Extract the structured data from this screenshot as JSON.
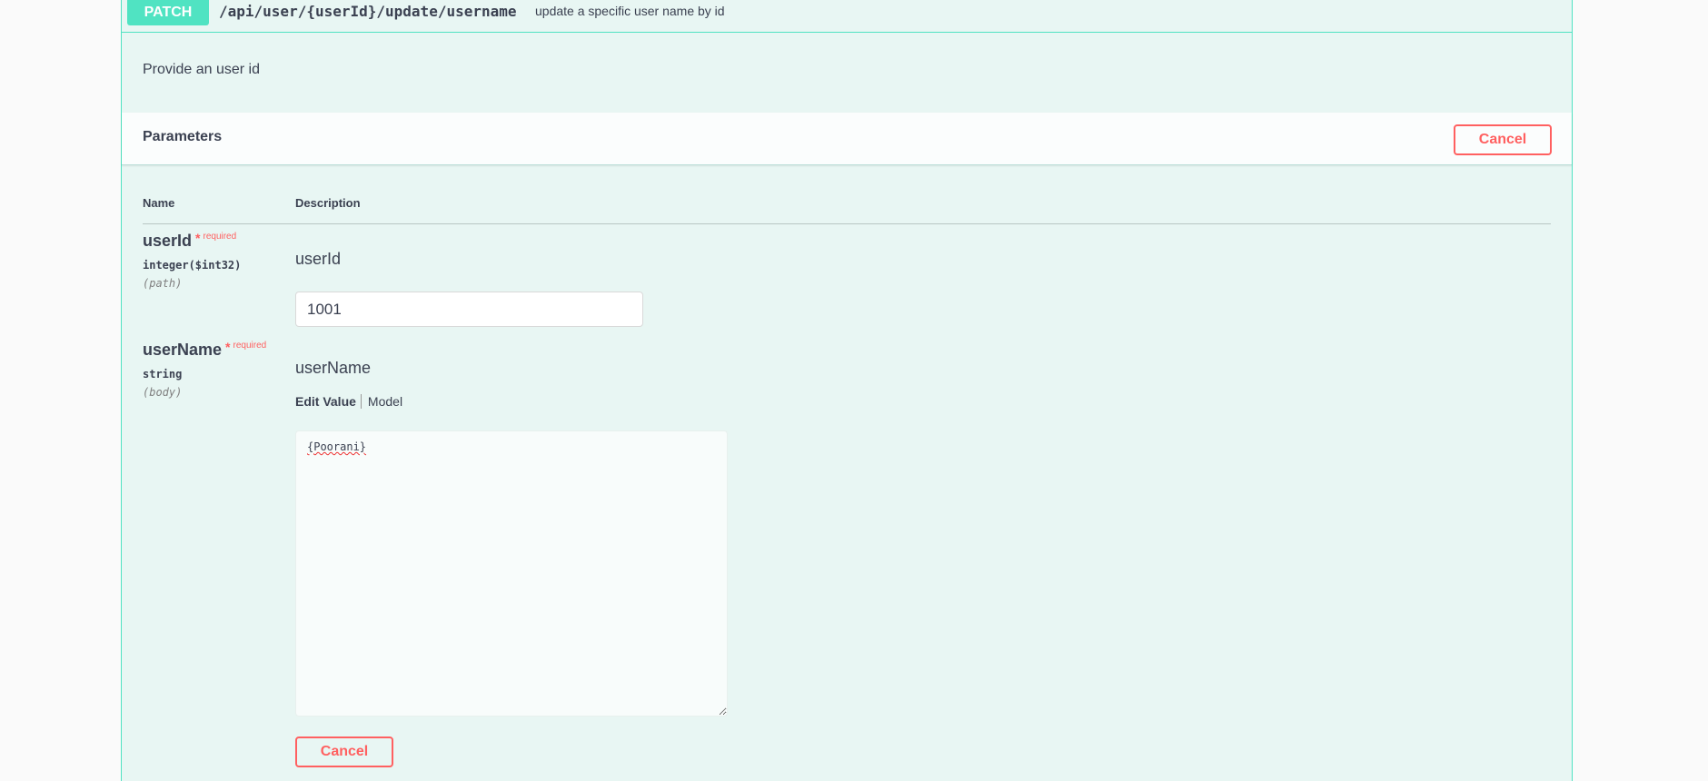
{
  "operation": {
    "method": "PATCH",
    "path": "/api/user/{userId}/update/username",
    "summary": "update a specific user name by id",
    "description": "Provide an user id"
  },
  "parameters": {
    "title": "Parameters",
    "cancel_label": "Cancel",
    "columns": {
      "name": "Name",
      "description": "Description"
    },
    "required_star": "*",
    "required_label": "required",
    "items": [
      {
        "name": "userId",
        "type": "integer($int32)",
        "in": "(path)",
        "label": "userId",
        "value": "1001"
      },
      {
        "name": "userName",
        "type": "string",
        "in": "(body)",
        "label": "userName",
        "value": "{Poorani}"
      }
    ]
  },
  "body_tabs": {
    "edit_value": "Edit Value",
    "model": "Model"
  },
  "bottom_cancel_label": "Cancel",
  "colors": {
    "patch": "#50e3c2",
    "cancel": "#ff6060",
    "background": "#e8f6f3"
  }
}
